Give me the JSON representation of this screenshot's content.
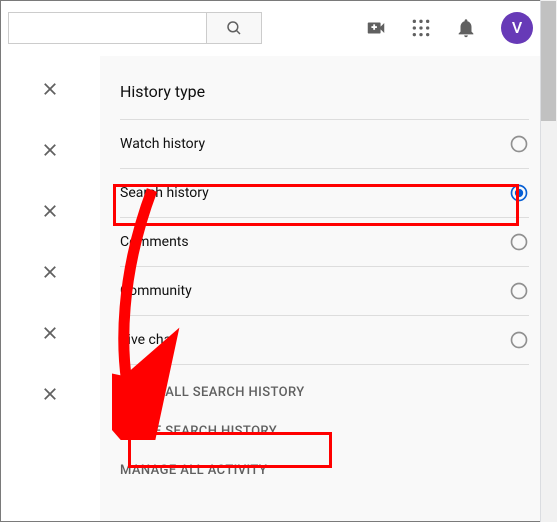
{
  "topbar": {
    "search_placeholder": "",
    "avatar_initial": "V"
  },
  "panel": {
    "title": "History type",
    "options": [
      {
        "label": "Watch history",
        "selected": false
      },
      {
        "label": "Search history",
        "selected": true
      },
      {
        "label": "Comments",
        "selected": false
      },
      {
        "label": "Community",
        "selected": false
      },
      {
        "label": "Live chat",
        "selected": false
      }
    ],
    "actions": {
      "clear": "CLEAR ALL SEARCH HISTORY",
      "pause": "PAUSE SEARCH HISTORY",
      "manage": "MANAGE ALL ACTIVITY"
    }
  },
  "colors": {
    "accent": "#065fd4",
    "highlight": "#ff0000",
    "avatar_bg": "#673ab7"
  }
}
